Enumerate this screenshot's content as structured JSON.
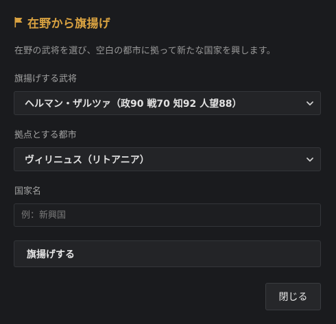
{
  "dialog": {
    "title": "在野から旗揚げ",
    "description": "在野の武将を選び、空白の都市に拠って新たな国家を興します。",
    "general_label": "旗揚げする武将",
    "general_selected": "ヘルマン・ザルツァ（政90 戦70 知92 人望88）",
    "city_label": "拠点とする都市",
    "city_selected": "ヴィリニュス（リトアニア）",
    "nation_label": "国家名",
    "nation_placeholder": "例：新興国",
    "nation_value": "",
    "submit_label": "旗揚げする",
    "close_label": "閉じる"
  },
  "icons": {
    "title_icon": "flag-icon",
    "select_icon": "chevron-down-icon"
  },
  "colors": {
    "accent": "#d9a241",
    "background": "#1a1b1e"
  }
}
